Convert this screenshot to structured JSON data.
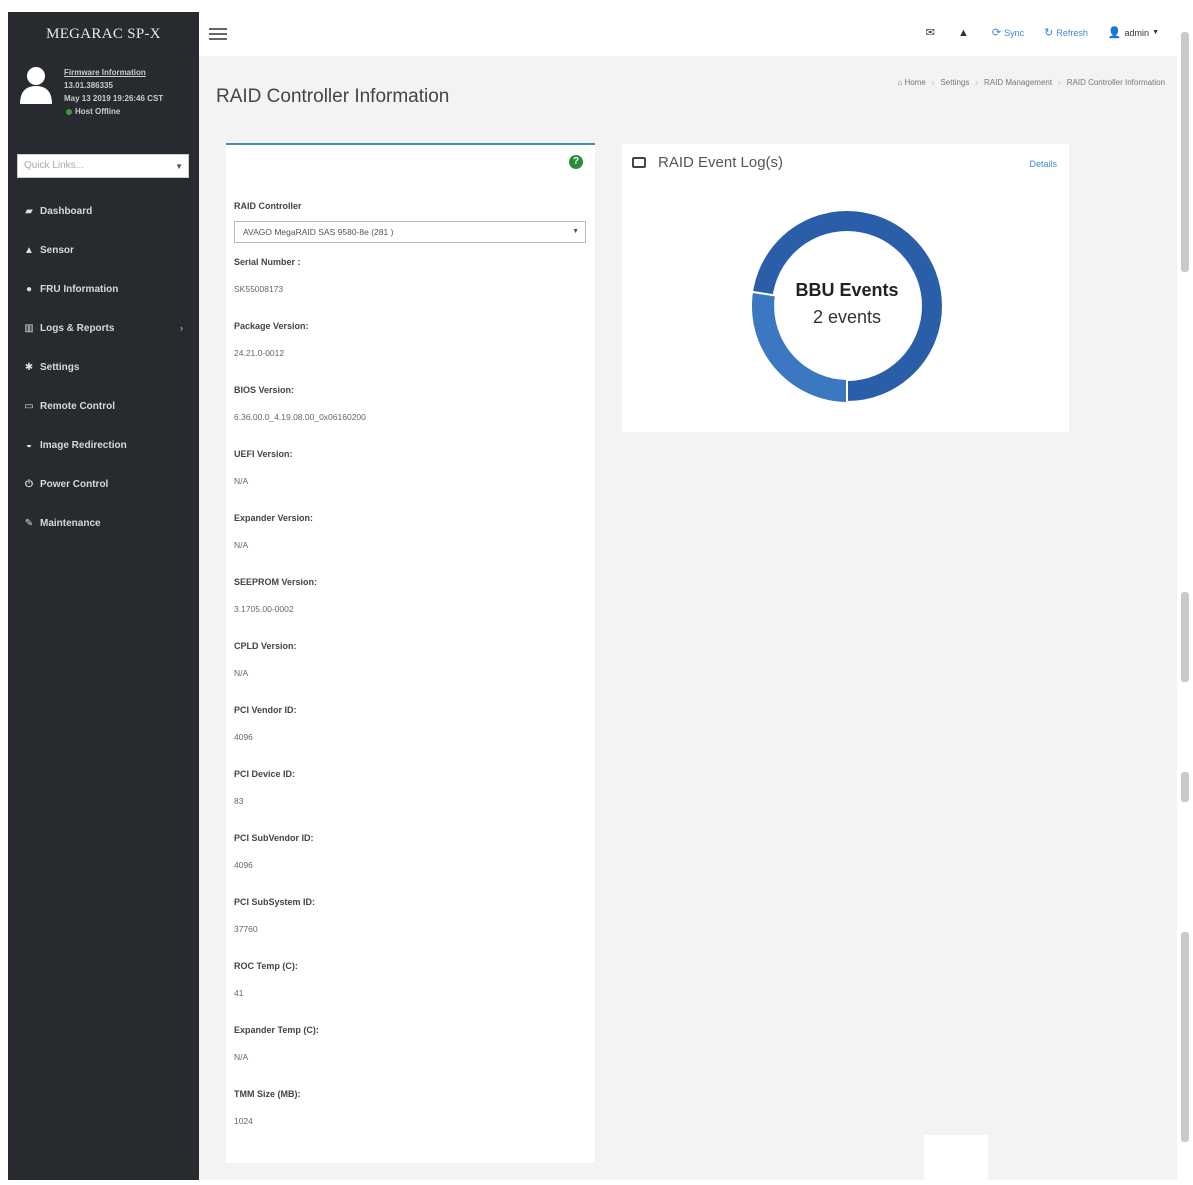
{
  "sidebar": {
    "brand": "MEGARAC SP-X",
    "user": {
      "firmware_link": "Firmware Information",
      "firmware_version": "13.01.386335",
      "build_date": "May 13 2019 19:26:46 CST",
      "status": "Host Offline"
    },
    "quick_links_placeholder": "Quick Links...",
    "items": [
      {
        "label": "Dashboard",
        "icon": "tachometer-icon",
        "glyph": "▰"
      },
      {
        "label": "Sensor",
        "icon": "sensor-icon",
        "glyph": "▲"
      },
      {
        "label": "FRU Information",
        "icon": "info-icon",
        "glyph": "●"
      },
      {
        "label": "Logs & Reports",
        "icon": "chart-icon",
        "glyph": "▥"
      },
      {
        "label": "Settings",
        "icon": "gear-icon",
        "glyph": "✱"
      },
      {
        "label": "Remote Control",
        "icon": "monitor-icon",
        "glyph": "▭"
      },
      {
        "label": "Image Redirection",
        "icon": "disc-icon",
        "glyph": "◒"
      },
      {
        "label": "Power Control",
        "icon": "power-icon",
        "glyph": "⏻"
      },
      {
        "label": "Maintenance",
        "icon": "wrench-icon",
        "glyph": "✎"
      }
    ]
  },
  "header": {
    "sync": "Sync",
    "refresh": "Refresh",
    "user": "admin"
  },
  "page": {
    "title": "RAID Controller Information",
    "breadcrumb": [
      "Home",
      "Settings",
      "RAID Management",
      "RAID Controller Information"
    ]
  },
  "controller": {
    "select_label": "RAID Controller",
    "selected": "AVAGO MegaRAID SAS 9580-8e (281 )",
    "fields": [
      {
        "label": "Serial Number :",
        "value": "SK55008173"
      },
      {
        "label": "Package Version:",
        "value": "24.21.0-0012"
      },
      {
        "label": "BIOS Version:",
        "value": "6.36.00.0_4.19.08.00_0x06160200"
      },
      {
        "label": "UEFI Version:",
        "value": "N/A"
      },
      {
        "label": "Expander Version:",
        "value": "N/A"
      },
      {
        "label": "SEEPROM Version:",
        "value": "3.1705.00-0002"
      },
      {
        "label": "CPLD Version:",
        "value": "N/A"
      },
      {
        "label": "PCI Vendor ID:",
        "value": "4096"
      },
      {
        "label": "PCI Device ID:",
        "value": "83"
      },
      {
        "label": "PCI SubVendor ID:",
        "value": "4096"
      },
      {
        "label": "PCI SubSystem ID:",
        "value": "37760"
      },
      {
        "label": "ROC Temp (C):",
        "value": "41"
      },
      {
        "label": "Expander Temp (C):",
        "value": "N/A"
      },
      {
        "label": "TMM Size (MB):",
        "value": "1024"
      }
    ]
  },
  "event_log": {
    "title": "RAID Event Log(s)",
    "details": "Details",
    "donut_title": "BBU Events",
    "donut_count": "2 events",
    "colors": {
      "main": "#2a5ea8",
      "secondary": "#3b78c1"
    }
  }
}
